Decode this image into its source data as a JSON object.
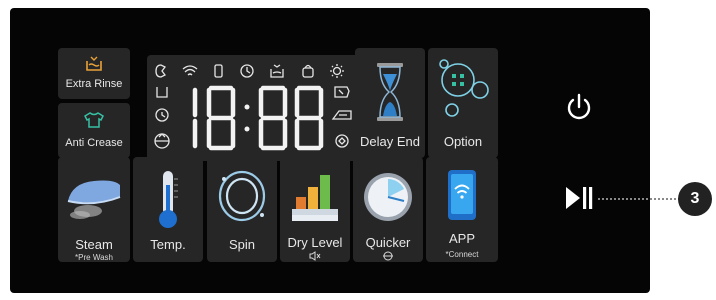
{
  "tiles": {
    "extra_rinse": "Extra Rinse",
    "anti_crease": "Anti Crease",
    "delay_end": "Delay End",
    "option": "Option",
    "steam": "Steam",
    "steam_sub": "*Pre Wash",
    "temp": "Temp.",
    "spin": "Spin",
    "dry_level": "Dry Level",
    "quicker": "Quicker",
    "app": "APP",
    "app_sub": "*Connect"
  },
  "display": {
    "digits": "18:88"
  },
  "callout": {
    "number": "3"
  },
  "colors": {
    "accent_orange": "#e8a23a",
    "accent_teal": "#37c1a4",
    "panel": "#050505",
    "tile": "#262626"
  }
}
